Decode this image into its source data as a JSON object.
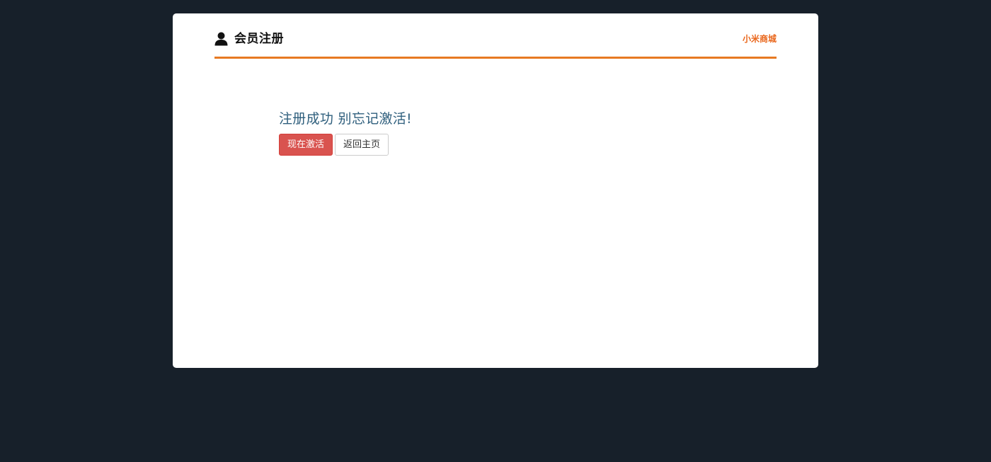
{
  "header": {
    "title": "会员注册",
    "brand_link": "小米商城",
    "icon": "user-icon"
  },
  "main": {
    "message": "注册成功 别忘记激活!",
    "activate_button": "现在激活",
    "home_button": "返回主页"
  },
  "colors": {
    "background": "#17202a",
    "accent": "#e77a22",
    "brand_link": "#e9661b",
    "message": "#2f5f7d",
    "danger": "#d9534f"
  }
}
